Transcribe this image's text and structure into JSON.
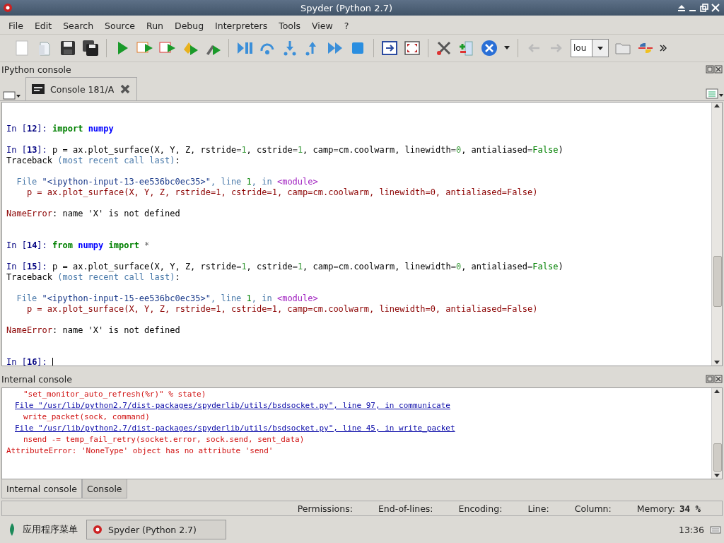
{
  "window": {
    "title": "Spyder (Python 2.7)"
  },
  "menu": [
    "File",
    "Edit",
    "Search",
    "Source",
    "Run",
    "Debug",
    "Interpreters",
    "Tools",
    "View",
    "?"
  ],
  "toolbar": {
    "combo_value": "lou"
  },
  "ipython_pane": {
    "title": "IPython console",
    "tabs": [
      {
        "label": "Console 181/A",
        "selected": true
      }
    ],
    "blocks": [
      {
        "kind": "input",
        "lines": [
          [
            {
              "text": "In [",
              "kind": "prompt"
            },
            {
              "text": "12",
              "kind": "promptnum"
            },
            {
              "text": "]: ",
              "kind": "prompt"
            },
            {
              "text": "import",
              "kind": "keyword"
            },
            {
              "text": " numpy",
              "kind": "name"
            }
          ]
        ]
      },
      {
        "kind": "input",
        "lines": [
          [
            {
              "text": "In [",
              "kind": "prompt"
            },
            {
              "text": "13",
              "kind": "promptnum"
            },
            {
              "text": "]: ",
              "kind": "prompt"
            },
            {
              "text": "p = ax.plot_surface(X, Y, Z, rstride",
              "kind": "plain"
            },
            {
              "text": "=",
              "kind": "op"
            },
            {
              "text": "1",
              "kind": "number"
            },
            {
              "text": ", cstride",
              "kind": "plain"
            },
            {
              "text": "=",
              "kind": "op"
            },
            {
              "text": "1",
              "kind": "number"
            },
            {
              "text": ", camp",
              "kind": "plain"
            },
            {
              "text": "=",
              "kind": "op"
            },
            {
              "text": "cm.coolwarm, linewidth",
              "kind": "plain"
            },
            {
              "text": "=",
              "kind": "op"
            },
            {
              "text": "0",
              "kind": "number"
            },
            {
              "text": ", antialiased",
              "kind": "plain"
            },
            {
              "text": "=",
              "kind": "op"
            },
            {
              "text": "False",
              "kind": "const"
            },
            {
              "text": ")",
              "kind": "plain"
            }
          ],
          [
            {
              "text": "Traceback ",
              "kind": "plain"
            },
            {
              "text": "(most recent call last)",
              "kind": "dim"
            },
            {
              "text": ":",
              "kind": "plain"
            }
          ]
        ]
      },
      {
        "kind": "output",
        "lines": [
          [
            {
              "text": "  File ",
              "kind": "dim"
            },
            {
              "text": "\"<ipython-input-13-ee536bc0ec35>\"",
              "kind": "path"
            },
            {
              "text": ", line ",
              "kind": "dim"
            },
            {
              "text": "1",
              "kind": "const"
            },
            {
              "text": ", in ",
              "kind": "dim"
            },
            {
              "text": "<module>",
              "kind": "module"
            }
          ],
          [
            {
              "text": "    p = ax.plot_surface(X, Y, Z, rstride=1, cstride=1, camp=cm.coolwarm, linewidth=0, antialiased=False)",
              "kind": "error"
            }
          ]
        ]
      },
      {
        "kind": "output",
        "lines": [
          [
            {
              "text": "NameError",
              "kind": "error"
            },
            {
              "text": ": name 'X' is not defined",
              "kind": "plain"
            }
          ]
        ]
      },
      {
        "kind": "input",
        "lines": [
          [
            {
              "text": "In [",
              "kind": "prompt"
            },
            {
              "text": "14",
              "kind": "promptnum"
            },
            {
              "text": "]: ",
              "kind": "prompt"
            },
            {
              "text": "from",
              "kind": "keyword"
            },
            {
              "text": " numpy",
              "kind": "name"
            },
            {
              "text": " import",
              "kind": "keyword"
            },
            {
              "text": " *",
              "kind": "op"
            }
          ]
        ]
      },
      {
        "kind": "input",
        "lines": [
          [
            {
              "text": "In [",
              "kind": "prompt"
            },
            {
              "text": "15",
              "kind": "promptnum"
            },
            {
              "text": "]: ",
              "kind": "prompt"
            },
            {
              "text": "p = ax.plot_surface(X, Y, Z, rstride",
              "kind": "plain"
            },
            {
              "text": "=",
              "kind": "op"
            },
            {
              "text": "1",
              "kind": "number"
            },
            {
              "text": ", cstride",
              "kind": "plain"
            },
            {
              "text": "=",
              "kind": "op"
            },
            {
              "text": "1",
              "kind": "number"
            },
            {
              "text": ", camp",
              "kind": "plain"
            },
            {
              "text": "=",
              "kind": "op"
            },
            {
              "text": "cm.coolwarm, linewidth",
              "kind": "plain"
            },
            {
              "text": "=",
              "kind": "op"
            },
            {
              "text": "0",
              "kind": "number"
            },
            {
              "text": ", antialiased",
              "kind": "plain"
            },
            {
              "text": "=",
              "kind": "op"
            },
            {
              "text": "False",
              "kind": "const"
            },
            {
              "text": ")",
              "kind": "plain"
            }
          ],
          [
            {
              "text": "Traceback ",
              "kind": "plain"
            },
            {
              "text": "(most recent call last)",
              "kind": "dim"
            },
            {
              "text": ":",
              "kind": "plain"
            }
          ]
        ]
      },
      {
        "kind": "output",
        "lines": [
          [
            {
              "text": "  File ",
              "kind": "dim"
            },
            {
              "text": "\"<ipython-input-15-ee536bc0ec35>\"",
              "kind": "path"
            },
            {
              "text": ", line ",
              "kind": "dim"
            },
            {
              "text": "1",
              "kind": "const"
            },
            {
              "text": ", in ",
              "kind": "dim"
            },
            {
              "text": "<module>",
              "kind": "module"
            }
          ],
          [
            {
              "text": "    p = ax.plot_surface(X, Y, Z, rstride=1, cstride=1, camp=cm.coolwarm, linewidth=0, antialiased=False)",
              "kind": "error"
            }
          ]
        ]
      },
      {
        "kind": "output",
        "lines": [
          [
            {
              "text": "NameError",
              "kind": "error"
            },
            {
              "text": ": name 'X' is not defined",
              "kind": "plain"
            }
          ]
        ]
      },
      {
        "kind": "input",
        "lines": [
          [
            {
              "text": "In [",
              "kind": "prompt"
            },
            {
              "text": "16",
              "kind": "promptnum"
            },
            {
              "text": "]: ",
              "kind": "prompt"
            }
          ]
        ],
        "cursor": true
      }
    ]
  },
  "internal_pane": {
    "title": "Internal console",
    "lines": [
      {
        "kind": "code",
        "text": "\"set_monitor_auto_refresh(%r)\" % state)"
      },
      {
        "kind": "link",
        "text": "File \"/usr/lib/python2.7/dist-packages/spyderlib/utils/bsdsocket.py\", line 97, in communicate"
      },
      {
        "kind": "code",
        "text": "write_packet(sock, command)"
      },
      {
        "kind": "link",
        "text": "File \"/usr/lib/python2.7/dist-packages/spyderlib/utils/bsdsocket.py\", line 45, in write_packet"
      },
      {
        "kind": "code",
        "text": "nsend -= temp_fail_retry(socket.error, sock.send, sent_data)"
      },
      {
        "kind": "error",
        "text": "AttributeError: 'NoneType' object has no attribute 'send'"
      }
    ]
  },
  "bottom_tabs": [
    {
      "label": "Internal console",
      "selected": true
    },
    {
      "label": "Console",
      "selected": false
    }
  ],
  "status_bar": [
    {
      "label": "Permissions:"
    },
    {
      "label": "End-of-lines:"
    },
    {
      "label": "Encoding:"
    },
    {
      "label": "Line:"
    },
    {
      "label": "Column:"
    },
    {
      "label": "Memory:",
      "value": "34 %"
    }
  ],
  "taskbar": {
    "menu_label": "应用程序菜单",
    "windows": [
      {
        "label": "Spyder (Python 2.7)",
        "selected": false
      }
    ],
    "clock": "13:36"
  }
}
